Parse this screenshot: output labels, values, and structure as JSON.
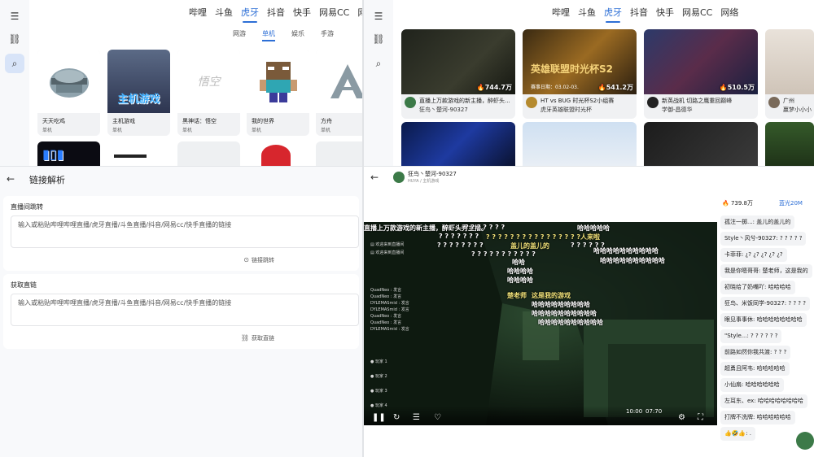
{
  "platforms": [
    "哔哩",
    "斗鱼",
    "虎牙",
    "抖音",
    "快手",
    "网易CC",
    "网络"
  ],
  "active_platform": "虎牙",
  "category_tabs": [
    "网游",
    "单机",
    "娱乐",
    "手游"
  ],
  "active_category": "单机",
  "games": [
    {
      "name": "天天吃鸡",
      "sub": "单机"
    },
    {
      "name": "主机游戏",
      "sub": "单机",
      "art": "主机游戏"
    },
    {
      "name": "黑神话：悟空",
      "sub": "单机",
      "art": "悟空"
    },
    {
      "name": "我的世界",
      "sub": "单机"
    },
    {
      "name": "方舟",
      "sub": "单机"
    }
  ],
  "rooms": [
    {
      "title": "直播上万款游戏的新主播，醉虾头...",
      "anchor": "狂鸟丶楚河-90327",
      "count": "744.7万"
    },
    {
      "title": "HT vs BUG 时光杯S2小组赛",
      "anchor": "虎牙英雄联盟时光杯",
      "count": "541.2万",
      "banner": "英雄联盟时光杯S2",
      "sub": "赛事日期：03.02-03."
    },
    {
      "title": "新英战机 切路之鹰重回巅峰",
      "anchor": "学御-昌德华",
      "count": "510.5万"
    },
    {
      "title": "广州",
      "anchor": "赢梦小小小",
      "count": ""
    }
  ],
  "link_page": {
    "title": "链接解析",
    "jump_label": "直播间跳转",
    "jump_placeholder": "输入或粘贴哔哩哔哩直播/虎牙直播/斗鱼直播/抖音/网易cc/快手直播的链接",
    "jump_button": "链接跳转",
    "direct_label": "获取直链",
    "direct_placeholder": "输入或粘贴哔哩哔哩直播/虎牙直播/斗鱼直播/抖音/网易cc/快手直播的链接",
    "direct_button": "获取直链"
  },
  "player": {
    "streamer": "狂鸟丶楚河-90327",
    "sub": "HUYA / 主机游戏",
    "viewers": "739.8万",
    "quality": "蓝光20M",
    "time_current": "10:00",
    "time_total": "07:70",
    "danmaku": [
      "直播上万款游戏的新主播，醉虾头秀主播。",
      "? ? ? ? ? ? ?",
      "哈哈哈哈哈",
      "? ? ? ? ? ? ? ? ? ? ? ? ? ? ? ?人来啦",
      "? ? ? ? ? ? ?",
      "? ? ? ? ? ? ? ?",
      "盖儿的盖儿的",
      "? ? ? ? ? ?",
      "哈哈哈哈哈哈哈哈哈哈",
      "? ? ? ? ? ? ? ? ? ? ?",
      "哈哈哈哈哈哈哈哈哈哈",
      "哈哈",
      "哈哈哈哈",
      "哈哈哈哈",
      "楚老师",
      "这是我的游戏",
      "哈哈哈哈哈哈哈哈哈",
      "哈哈哈哈哈哈哈哈哈哈",
      "哈哈哈哈哈哈哈哈哈哈"
    ],
    "chat": [
      "孤注一掷...: 盖儿的盖儿的",
      "Style丶风兮-90327: ? ? ? ? ?",
      "卡菲菲: ¿? ¿? ¿? ¿? ¿?",
      "我是你嗯哥哥: 楚老师，这是我的",
      "初晓给了奶嘴吖: 哈哈哈哈",
      "狂鸟、米饭同学-90327: ? ? ? ?",
      "眼见事事休: 哈哈哈哈哈哈哈哈",
      "\"Style...: ? ? ? ? ? ?",
      "前路如然你我共渡: ? ? ?",
      "超勇且阿韦: 哈哈哈哈哈",
      "小仙扇: 哈哈哈哈哈哈",
      "左耳东、ex: 哈哈哈哈哈哈哈哈",
      "打牌不洗牌: 哈哈哈哈哈哈",
      "👍🤣👍: ."
    ]
  }
}
